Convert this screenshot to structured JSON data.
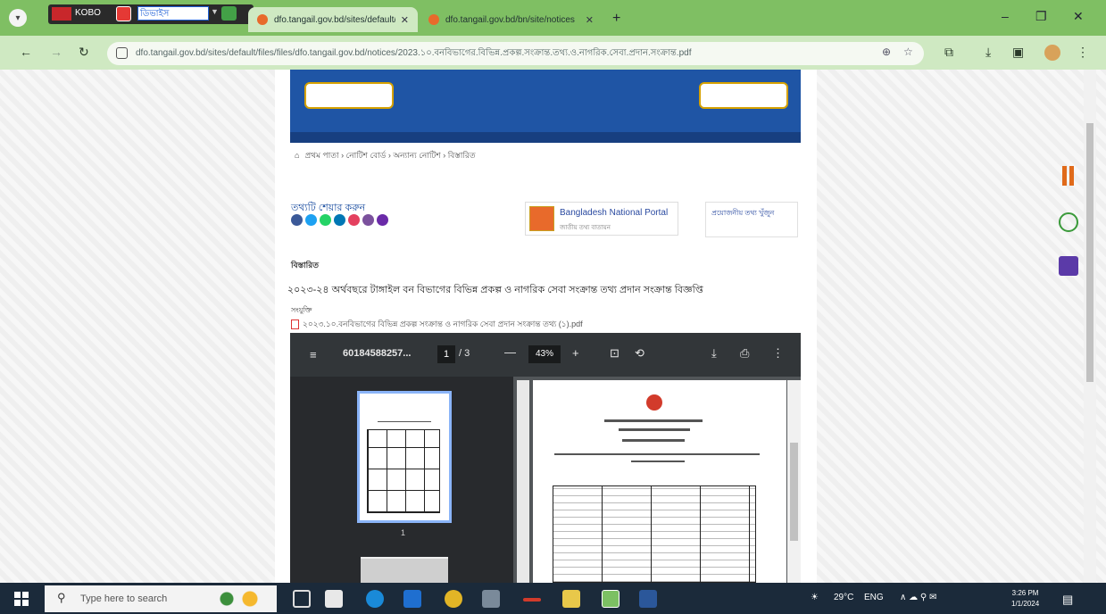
{
  "browser": {
    "overlay": {
      "app_label": "KOBO",
      "input_value": "ডিভাইস"
    },
    "tabs": [
      {
        "title": "dfo.tangail.gov.bd/sites/default/fi...",
        "active": true
      },
      {
        "title": "dfo.tangail.gov.bd/bn/site/notices",
        "active": false
      }
    ],
    "new_tab": "+",
    "window_controls": {
      "minimize": "–",
      "maximize": "❐",
      "close": "✕"
    },
    "nav": {
      "back": "←",
      "forward": "→",
      "reload": "↻"
    },
    "url": "dfo.tangail.gov.bd/sites/default/files/files/dfo.tangail.gov.bd/notices/2023.১০.বনবিভাগের.বিভিন্ন.প্রকল্প.সংক্রান্ত.তথ্য.ও.নাগরিক.সেবা.প্রদান.সংক্রান্ত.pdf",
    "omni_icons": {
      "zoom": "⊕",
      "star": "☆"
    },
    "toolbar_icons": {
      "extensions": "⧉",
      "download": "⤓",
      "sidepanel": "▣",
      "menu": "⋮"
    }
  },
  "page": {
    "breadcrumb": "প্রথম পাতা › নোটিশ বোর্ড › অন্যান্য নোটিশ › বিস্তারিত",
    "share_text": "তথ্যটি শেয়ার করুন",
    "share_colors": [
      "#3b5998",
      "#1da1f2",
      "#25d366",
      "#0077b5",
      "#e4405f",
      "#7b519d",
      "#6a2aa8"
    ],
    "portal": {
      "name": "Bangladesh National Portal",
      "sub": "জাতীয় তথ্য বাতায়ন"
    },
    "search_box": "প্রয়োজনীয় তথ্য খুঁজুন",
    "section_label": "বিস্তারিত",
    "notice_title": "২০২৩-২৪ অর্থবছরে টাঙ্গাইল বন বিভাগের বিভিন্ন প্রকল্প ও নাগরিক সেবা সংক্রান্ত তথ্য প্রদান সংক্রান্ত বিজ্ঞপ্তি",
    "small_label": "সংযুক্তি",
    "pdf_link": "২০২৩.১০.বনবিভাগের বিভিন্ন প্রকল্প সংক্রান্ত ও নাগরিক সেবা প্রদান সংক্রান্ত তথ্য (১).pdf"
  },
  "pdf_viewer": {
    "menu_icon": "≡",
    "title": "60184588257...",
    "page_current": "1",
    "page_total": "/ 3",
    "zoom_out": "—",
    "zoom": "43%",
    "zoom_in": "+",
    "fit_icon": "⊡",
    "rotate_icon": "⟲",
    "download_icon": "⤓",
    "print_icon": "⎙",
    "more_icon": "⋮",
    "thumbnail_page": "1"
  },
  "taskbar": {
    "search_placeholder": "Type here to search",
    "tray": {
      "weather": "29°C",
      "lang": "ENG",
      "tray_icons": "∧ ☁ ⚲ ✉"
    },
    "clock_time": "3:26 PM",
    "clock_date": "1/1/2024"
  },
  "colors": {
    "tab_bar": "#7fbf63",
    "nav_bar": "#cfe9c2",
    "banner": "#1f55a5",
    "pdf_toolbar": "#323639",
    "taskbar": "#1b2a3a"
  }
}
